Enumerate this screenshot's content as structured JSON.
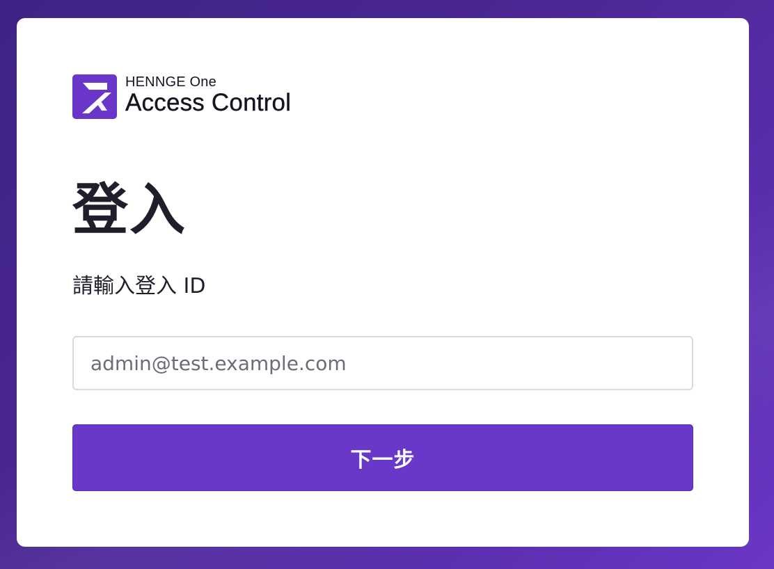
{
  "brand": {
    "company": "HENNGE One",
    "product": "Access Control",
    "logo_icon": "henngeone-z-logo-icon",
    "accent_color": "#6a35c9"
  },
  "login": {
    "title": "登入",
    "prompt": "請輸入登入 ID",
    "id_input": {
      "value": "",
      "placeholder": "admin@test.example.com"
    },
    "next_button_label": "下一步"
  },
  "colors": {
    "background": "#4a2792",
    "button": "#6938c9",
    "text": "#1f1f2b"
  }
}
